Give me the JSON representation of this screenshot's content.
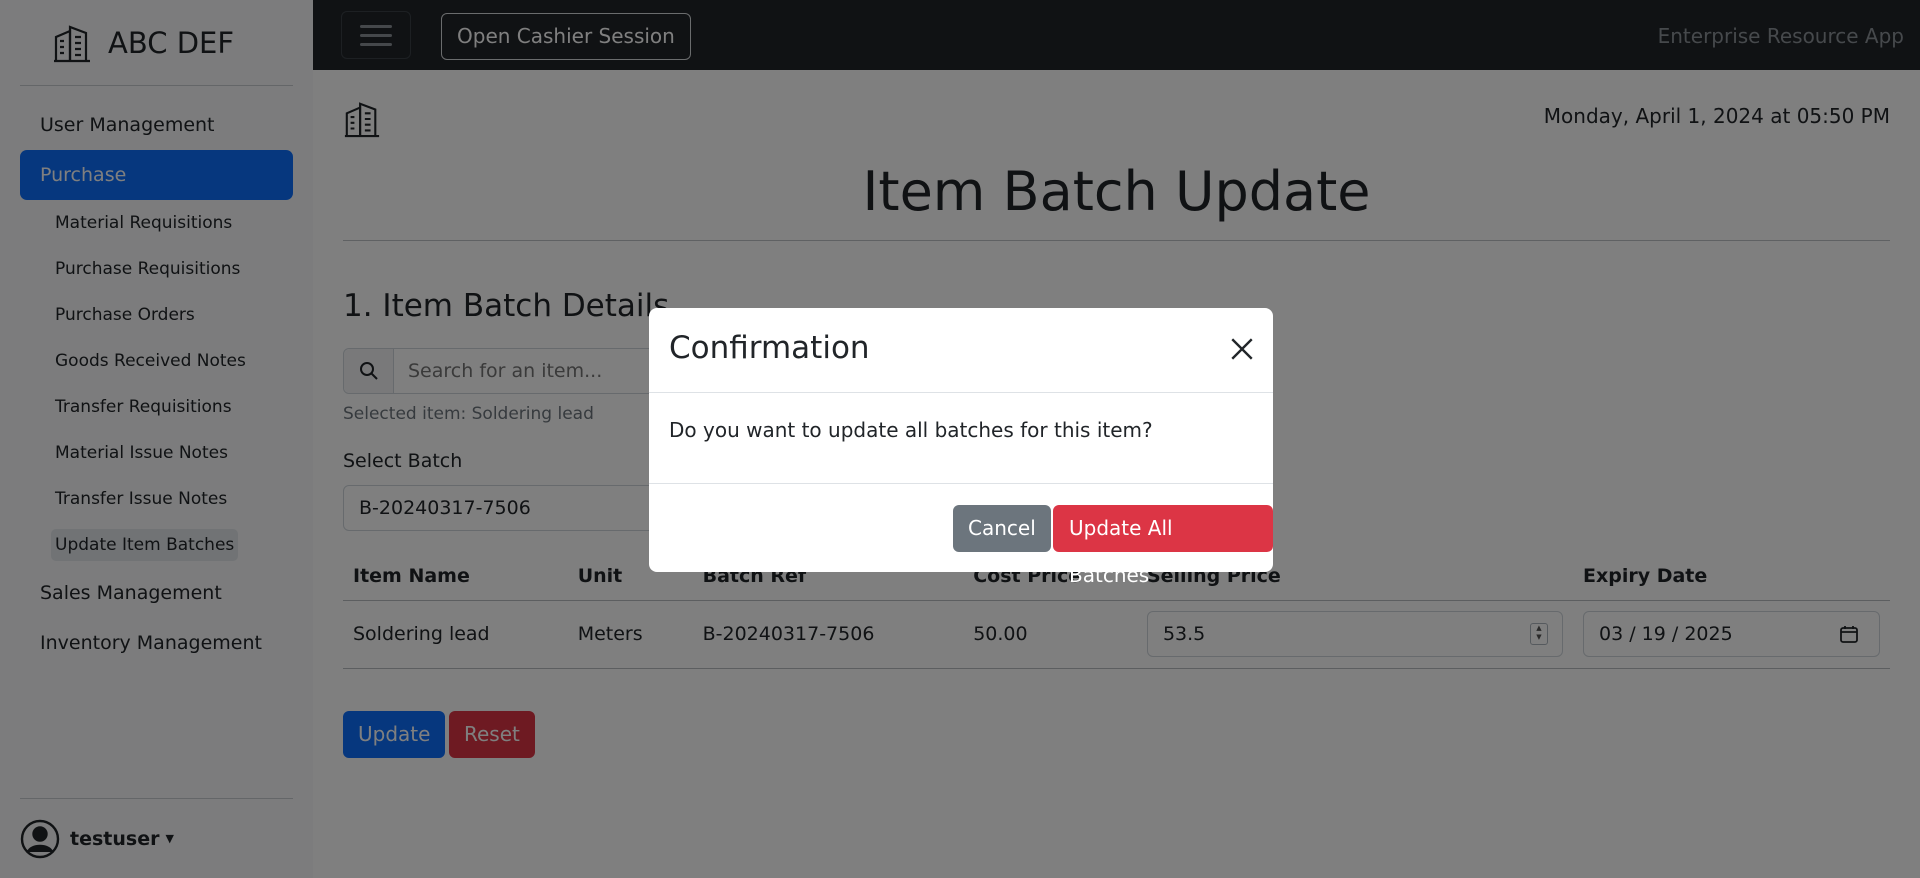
{
  "sidebar": {
    "brand": "ABC DEF",
    "items": [
      {
        "label": "User Management"
      },
      {
        "label": "Purchase"
      },
      {
        "label": "Sales Management"
      },
      {
        "label": "Inventory Management"
      }
    ],
    "purchase_sub": [
      {
        "label": "Material Requisitions"
      },
      {
        "label": "Purchase Requisitions"
      },
      {
        "label": "Purchase Orders"
      },
      {
        "label": "Goods Received Notes"
      },
      {
        "label": "Transfer Requisitions"
      },
      {
        "label": "Material Issue Notes"
      },
      {
        "label": "Transfer Issue Notes"
      },
      {
        "label": "Update Item Batches"
      }
    ],
    "user": "testuser"
  },
  "topbar": {
    "cashier_button": "Open Cashier Session",
    "app_title": "Enterprise Resource App"
  },
  "main": {
    "datetime": "Monday, April 1, 2024 at 05:50 PM",
    "title": "Item Batch Update",
    "section_title": "1. Item Batch Details",
    "search_placeholder": "Search for an item...",
    "selected_item": "Selected item: Soldering lead",
    "batch_label": "Select Batch",
    "batch_value": "B-20240317-7506",
    "table": {
      "headers": [
        "Item Name",
        "Unit",
        "Batch Ref",
        "Cost Price",
        "Selling Price",
        "Expiry Date"
      ],
      "row": {
        "item_name": "Soldering lead",
        "unit": "Meters",
        "batch_ref": "B-20240317-7506",
        "cost_price": "50.00",
        "selling_price": "53.5",
        "expiry_date": "03 / 19 / 2025"
      }
    },
    "update_button": "Update",
    "reset_button": "Reset"
  },
  "modal": {
    "title": "Confirmation",
    "body": "Do you want to update all batches for this item?",
    "cancel": "Cancel",
    "confirm": "Update All Batches"
  },
  "colors": {
    "primary": "#0d6efd",
    "danger": "#dc3545",
    "secondary": "#6c757d",
    "navbar": "#212529"
  }
}
